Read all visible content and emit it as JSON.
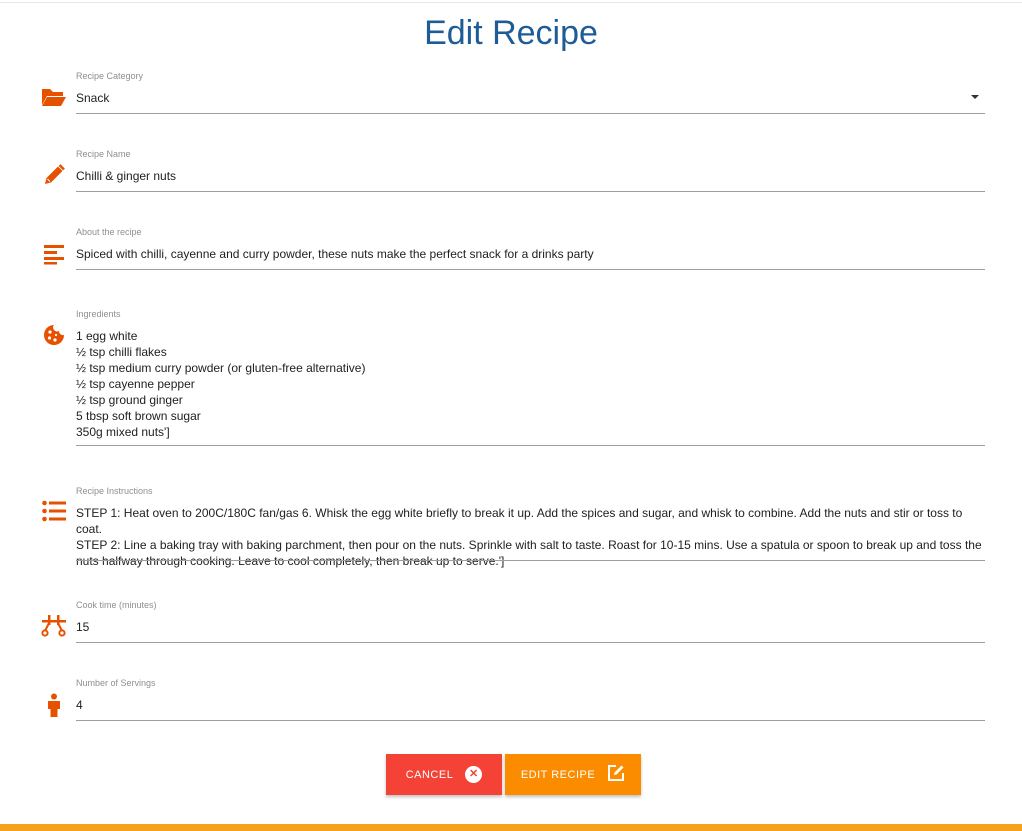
{
  "page": {
    "title": "Edit Recipe"
  },
  "fields": {
    "category": {
      "label": "Recipe Category",
      "value": "Snack",
      "icon": "folder-open-icon"
    },
    "name": {
      "label": "Recipe Name",
      "value": "Chilli & ginger nuts",
      "icon": "pencil-icon"
    },
    "about": {
      "label": "About the recipe",
      "value": "Spiced with chilli, cayenne and curry powder, these nuts make the perfect snack for a drinks party",
      "icon": "align-left-icon"
    },
    "ingredients": {
      "label": "Ingredients",
      "icon": "cookie-icon",
      "lines": [
        "1 egg white",
        "½ tsp chilli flakes",
        "½ tsp medium curry powder (or gluten-free alternative)",
        "½ tsp cayenne pepper",
        "½ tsp ground ginger",
        "5 tbsp soft brown sugar",
        "350g mixed nuts']"
      ]
    },
    "instructions": {
      "label": "Recipe Instructions",
      "icon": "list-icon",
      "lines": [
        "STEP 1: Heat oven to 200C/180C fan/gas 6. Whisk the egg white briefly to break it up. Add the spices and sugar, and whisk to combine. Add the nuts and stir or toss to coat.",
        "STEP 2: Line a baking tray with baking parchment, then pour on the nuts. Sprinkle with salt to taste. Roast for 10-15 mins. Use a spatula or spoon to break up and toss the nuts halfway through cooking. Leave to cool completely, then break up to serve.']"
      ]
    },
    "cook_time": {
      "label": "Cook time (minutes)",
      "value": "15",
      "icon": "timeline-icon"
    },
    "servings": {
      "label": "Number of Servings",
      "value": "4",
      "icon": "person-icon"
    }
  },
  "buttons": {
    "cancel": {
      "label": "CANCEL",
      "icon": "cancel-circle-icon"
    },
    "edit": {
      "label": "EDIT RECIPE",
      "icon": "edit-square-icon"
    }
  },
  "colors": {
    "accent_orange": "#e65100",
    "title_blue": "#1d5c96",
    "cancel_red": "#f44336",
    "edit_orange": "#fb8c00",
    "footer_orange": "#f7a21d"
  }
}
